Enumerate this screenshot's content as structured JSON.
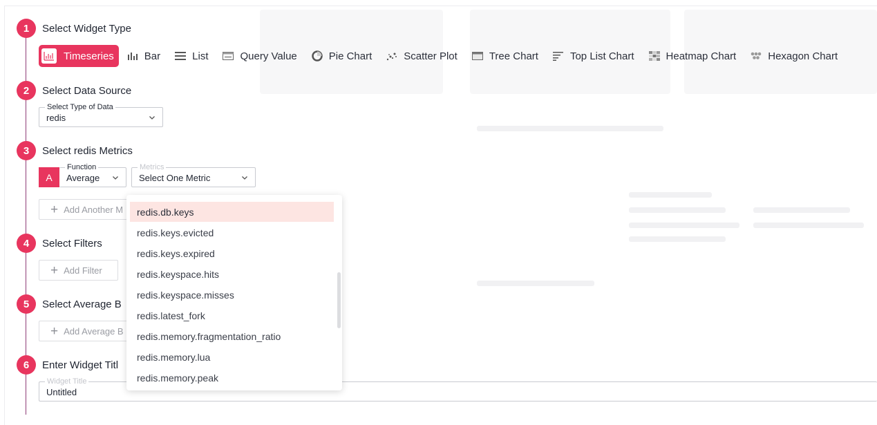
{
  "steps": [
    {
      "num": "1",
      "title": "Select Widget Type"
    },
    {
      "num": "2",
      "title": "Select Data Source"
    },
    {
      "num": "3",
      "title": "Select redis Metrics"
    },
    {
      "num": "4",
      "title": "Select Filters"
    },
    {
      "num": "5",
      "title": "Select Average B"
    },
    {
      "num": "6",
      "title": "Enter Widget Titl"
    }
  ],
  "widget_types": [
    {
      "label": "Timeseries",
      "icon": "timeseries-icon",
      "active": true
    },
    {
      "label": "Bar",
      "icon": "bar-chart-icon"
    },
    {
      "label": "List",
      "icon": "list-icon"
    },
    {
      "label": "Query Value",
      "icon": "query-value-icon"
    },
    {
      "label": "Pie Chart",
      "icon": "pie-chart-icon"
    },
    {
      "label": "Scatter Plot",
      "icon": "scatter-plot-icon"
    },
    {
      "label": "Tree Chart",
      "icon": "tree-chart-icon"
    },
    {
      "label": "Top List Chart",
      "icon": "top-list-icon"
    },
    {
      "label": "Heatmap Chart",
      "icon": "heatmap-icon"
    },
    {
      "label": "Hexagon Chart",
      "icon": "hexagon-icon"
    }
  ],
  "data_source": {
    "label": "Select Type of Data",
    "value": "redis"
  },
  "metric": {
    "letter": "A",
    "function_label": "Function",
    "function_value": "Average",
    "metrics_label": "Metrics",
    "metrics_placeholder": "Select One Metric"
  },
  "buttons": {
    "add_metric": "Add Another M",
    "add_filter": "Add Filter",
    "add_average": "Add Average B"
  },
  "widget_title": {
    "label": "Widget Title",
    "value": "Untitled"
  },
  "dropdown_items": [
    "redis.db.keys",
    "redis.keys.evicted",
    "redis.keys.expired",
    "redis.keyspace.hits",
    "redis.keyspace.misses",
    "redis.latest_fork",
    "redis.memory.fragmentation_ratio",
    "redis.memory.lua",
    "redis.memory.peak"
  ],
  "colors": {
    "accent": "#e8355e",
    "highlight": "#fde5e2",
    "timeline": "#8d3b76"
  }
}
